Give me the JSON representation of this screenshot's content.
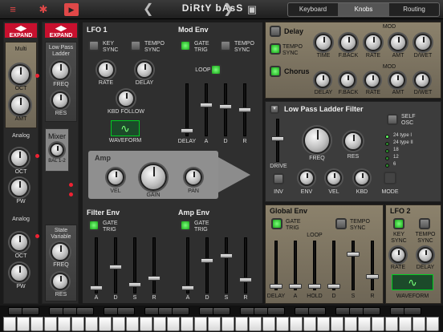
{
  "topbar": {
    "title": "DiRtY bAsS",
    "prev_icon": "chevron-left",
    "next_icon": "chevron-right",
    "tabs": [
      {
        "label": "Keyboard"
      },
      {
        "label": "Knobs"
      },
      {
        "label": "Routing"
      }
    ],
    "active_tab": "Knobs"
  },
  "left": {
    "expand1": "EXPAND",
    "expand2": "EXPAND",
    "osc1_type": "Multi",
    "oct": "OCT",
    "amt": "AMT",
    "osc2_type": "Analog",
    "oct2": "OCT",
    "pw": "PW",
    "osc3_type": "Analog",
    "oct3": "OCT",
    "pw3": "PW",
    "filter1_type": "Low Pass Ladder",
    "freq": "FREQ",
    "res": "RES",
    "mixer": "Mixer",
    "bal": "BAL 1-2",
    "filter2_type": "State Variable",
    "freq2": "FREQ",
    "res2": "RES"
  },
  "lfo1": {
    "title": "LFO 1",
    "key_sync": "KEY SYNC",
    "tempo_sync": "TEMPO SYNC",
    "rate": "RATE",
    "delay": "DELAY",
    "kbd_follow": "KBD FOLLOW",
    "waveform": "WAVEFORM",
    "wave_glyph": "∿"
  },
  "modenv": {
    "title": "Mod Env",
    "gate_trig": "GATE TRIG",
    "tempo_sync": "TEMPO SYNC",
    "loop": "LOOP",
    "labels": [
      "DELAY",
      "A",
      "D",
      "R",
      "R"
    ]
  },
  "amp": {
    "title": "Amp",
    "vel": "VEL",
    "gain": "GAIN",
    "pan": "PAN"
  },
  "filterenv": {
    "title": "Filter Env",
    "gate_trig": "GATE TRIG",
    "labels": [
      "A",
      "D",
      "S",
      "R"
    ]
  },
  "ampenv": {
    "title": "Amp Env",
    "gate_trig": "GATE TRIG",
    "labels": [
      "A",
      "D",
      "S",
      "R"
    ]
  },
  "delay": {
    "title": "Delay",
    "tempo_sync": "TEMPO SYNC",
    "mod": "MOD",
    "knobs": [
      "TIME",
      "F.BACK",
      "RATE",
      "AMT",
      "D/WET"
    ]
  },
  "chorus": {
    "title": "Chorus",
    "mod": "MOD",
    "knobs": [
      "DELAY",
      "F.BACK",
      "RATE",
      "AMT",
      "D/WET"
    ]
  },
  "lpfilter": {
    "title": "Low Pass Ladder Filter",
    "self_osc": "SELF OSC",
    "drive": "DRIVE",
    "freq": "FREQ",
    "res": "RES",
    "env": "ENV",
    "vel": "VEL",
    "kbd": "KBD",
    "inv": "INV",
    "mode": "MODE",
    "modes": [
      "24 type I",
      "24 type II",
      "18",
      "12",
      "6"
    ]
  },
  "globalenv": {
    "title": "Global Env",
    "gate_trig": "GATE TRIG",
    "tempo_sync": "TEMPO SYNC",
    "loop": "LOOP",
    "labels": [
      "DELAY",
      "A",
      "HOLD",
      "D",
      "S",
      "R"
    ]
  },
  "lfo2": {
    "title": "LFO 2",
    "key_sync": "KEY SYNC",
    "tempo_sync": "TEMPO SYNC",
    "rate": "RATE",
    "delay": "DELAY",
    "waveform": "WAVEFORM",
    "wave_glyph": "∿"
  },
  "colors": {
    "accent": "#c8102e",
    "led_green": "#3fd43f",
    "panel": "#444444",
    "fx_panel": "#8c826c"
  }
}
